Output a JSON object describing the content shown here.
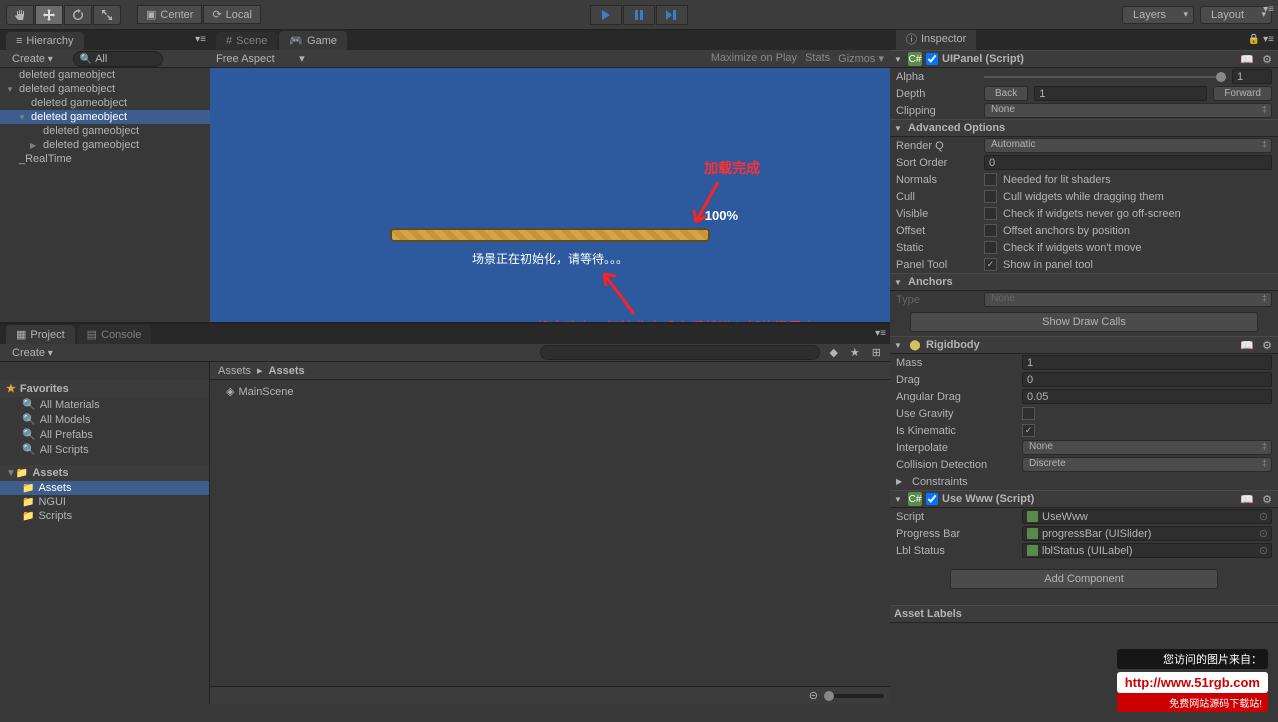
{
  "toolbar": {
    "center": "Center",
    "local": "Local",
    "layers": "Layers",
    "layout": "Layout"
  },
  "hierarchy": {
    "tab": "Hierarchy",
    "create": "Create",
    "filterAll": "All",
    "items": [
      {
        "label": "deleted gameobject",
        "indent": 0,
        "arrow": "",
        "selected": false
      },
      {
        "label": "deleted gameobject",
        "indent": 0,
        "arrow": "▼",
        "selected": false
      },
      {
        "label": "deleted gameobject",
        "indent": 1,
        "arrow": "",
        "selected": false
      },
      {
        "label": "deleted gameobject",
        "indent": 1,
        "arrow": "▼",
        "selected": true
      },
      {
        "label": "deleted gameobject",
        "indent": 2,
        "arrow": "",
        "selected": false
      },
      {
        "label": "deleted gameobject",
        "indent": 2,
        "arrow": "▶",
        "selected": false
      },
      {
        "label": "_RealTime",
        "indent": 0,
        "arrow": "",
        "selected": false
      }
    ]
  },
  "scene": {
    "tab": "Scene"
  },
  "game": {
    "tab": "Game",
    "aspect": "Free Aspect",
    "maximize": "Maximize on Play",
    "stats": "Stats",
    "gizmos": "Gizmos",
    "progressPct": "100%",
    "progressText": "场景正在初始化，请等待。。。",
    "annotation1": "加载完成",
    "annotation2": "状态改变，初始化完成之后就进入新的场景中"
  },
  "project": {
    "tab": "Project",
    "consoleTab": "Console",
    "create": "Create",
    "favorites": "Favorites",
    "favItems": [
      "All Materials",
      "All Models",
      "All Prefabs",
      "All Scripts"
    ],
    "assetsHeader": "Assets",
    "folders": [
      {
        "label": "Assets",
        "selected": true
      },
      {
        "label": "NGUI",
        "selected": false
      },
      {
        "label": "Scripts",
        "selected": false
      }
    ],
    "breadcrumb": [
      "Assets",
      "Assets"
    ],
    "content": [
      "MainScene"
    ]
  },
  "inspector": {
    "tab": "Inspector",
    "uipanel": {
      "title": "UIPanel (Script)",
      "alpha": {
        "label": "Alpha",
        "value": "1"
      },
      "depth": {
        "label": "Depth",
        "back": "Back",
        "value": "1",
        "forward": "Forward"
      },
      "clipping": {
        "label": "Clipping",
        "value": "None"
      },
      "advancedTitle": "Advanced Options",
      "renderQ": {
        "label": "Render Q",
        "value": "Automatic"
      },
      "sortOrder": {
        "label": "Sort Order",
        "value": "0"
      },
      "normals": {
        "label": "Normals",
        "desc": "Needed for lit shaders"
      },
      "cull": {
        "label": "Cull",
        "desc": "Cull widgets while dragging them"
      },
      "visible": {
        "label": "Visible",
        "desc": "Check if widgets never go off-screen"
      },
      "offset": {
        "label": "Offset",
        "desc": "Offset anchors by position"
      },
      "static": {
        "label": "Static",
        "desc": "Check if widgets won't move"
      },
      "panelTool": {
        "label": "Panel Tool",
        "desc": "Show in panel tool"
      },
      "anchorsTitle": "Anchors",
      "type": {
        "label": "Type",
        "value": "None"
      },
      "showDrawCalls": "Show Draw Calls"
    },
    "rigidbody": {
      "title": "Rigidbody",
      "mass": {
        "label": "Mass",
        "value": "1"
      },
      "drag": {
        "label": "Drag",
        "value": "0"
      },
      "angularDrag": {
        "label": "Angular Drag",
        "value": "0.05"
      },
      "useGravity": {
        "label": "Use Gravity"
      },
      "isKinematic": {
        "label": "Is Kinematic"
      },
      "interpolate": {
        "label": "Interpolate",
        "value": "None"
      },
      "collisionDetection": {
        "label": "Collision Detection",
        "value": "Discrete"
      },
      "constraints": {
        "label": "Constraints"
      }
    },
    "useWww": {
      "title": "Use Www (Script)",
      "script": {
        "label": "Script",
        "value": "UseWww"
      },
      "progressBar": {
        "label": "Progress Bar",
        "value": "progressBar (UISlider)"
      },
      "lblStatus": {
        "label": "Lbl Status",
        "value": "lblStatus (UILabel)"
      }
    },
    "addComponent": "Add Component",
    "assetLabels": "Asset Labels"
  },
  "watermark": {
    "top": "您访问的图片来自：",
    "url": "http://www.51rgb.com",
    "sub": "免费网站源码下载站!"
  }
}
